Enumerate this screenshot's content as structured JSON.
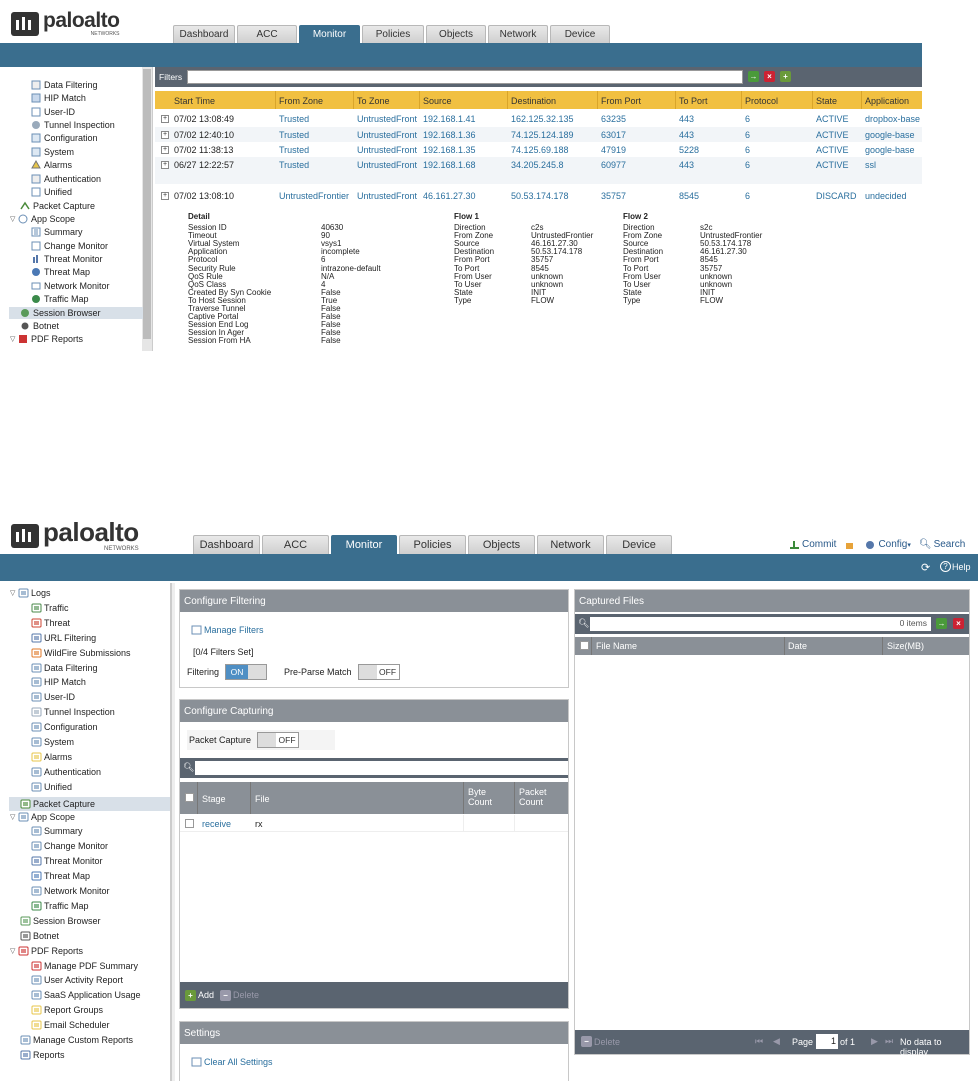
{
  "top": {
    "brand": {
      "wordmark": "paloalto",
      "sub": "NETWORKS"
    },
    "tabs": [
      "Dashboard",
      "ACC",
      "Monitor",
      "Policies",
      "Objects",
      "Network",
      "Device"
    ],
    "active_tab": "Monitor",
    "filters_label": "Filters",
    "tree": [
      "Data Filtering",
      "HIP Match",
      "User-ID",
      "Tunnel Inspection",
      "Configuration",
      "System",
      "Alarms",
      "Authentication",
      "Unified",
      "Packet Capture",
      "App Scope",
      "Summary",
      "Change Monitor",
      "Threat Monitor",
      "Threat Map",
      "Network Monitor",
      "Traffic Map",
      "Session Browser",
      "Botnet",
      "PDF Reports"
    ],
    "columns": [
      "Start Time",
      "From Zone",
      "To Zone",
      "Source",
      "Destination",
      "From Port",
      "To Port",
      "Protocol",
      "State",
      "Application"
    ],
    "rows": [
      [
        "07/02 13:08:49",
        "Trusted",
        "UntrustedFront...",
        "192.168.1.41",
        "162.125.32.135",
        "63235",
        "443",
        "6",
        "ACTIVE",
        "dropbox-base"
      ],
      [
        "07/02 12:40:10",
        "Trusted",
        "UntrustedFront...",
        "192.168.1.36",
        "74.125.124.189",
        "63017",
        "443",
        "6",
        "ACTIVE",
        "google-base"
      ],
      [
        "07/02 11:38:13",
        "Trusted",
        "UntrustedFront...",
        "192.168.1.35",
        "74.125.69.188",
        "47919",
        "5228",
        "6",
        "ACTIVE",
        "google-base"
      ],
      [
        "06/27 12:22:57",
        "Trusted",
        "UntrustedFront...",
        "192.168.1.68",
        "34.205.245.8",
        "60977",
        "443",
        "6",
        "ACTIVE",
        "ssl"
      ],
      [
        "07/02 13:08:10",
        "UntrustedFrontier",
        "UntrustedFront...",
        "46.161.27.30",
        "50.53.174.178",
        "35757",
        "8545",
        "6",
        "DISCARD",
        "undecided"
      ]
    ],
    "detail": {
      "title": "Detail",
      "rows": [
        [
          "Session ID",
          "40630"
        ],
        [
          "Timeout",
          "90"
        ],
        [
          "Virtual System",
          "vsys1"
        ],
        [
          "Application",
          "incomplete"
        ],
        [
          "Protocol",
          "6"
        ],
        [
          "Security Rule",
          "intrazone-default"
        ],
        [
          "QoS Rule",
          "N/A"
        ],
        [
          "QoS Class",
          "4"
        ],
        [
          "Created By Syn Cookie",
          "False"
        ],
        [
          "To Host Session",
          "True"
        ],
        [
          "Traverse Tunnel",
          "False"
        ],
        [
          "Captive Portal",
          "False"
        ],
        [
          "Session End Log",
          "False"
        ],
        [
          "Session In Ager",
          "False"
        ],
        [
          "Session From HA",
          "False"
        ]
      ]
    },
    "flow1": {
      "title": "Flow 1",
      "rows": [
        [
          "Direction",
          "c2s"
        ],
        [
          "From Zone",
          "UntrustedFrontier"
        ],
        [
          "Source",
          "46.161.27.30"
        ],
        [
          "Destination",
          "50.53.174.178"
        ],
        [
          "From Port",
          "35757"
        ],
        [
          "To Port",
          "8545"
        ],
        [
          "From User",
          "unknown"
        ],
        [
          "To User",
          "unknown"
        ],
        [
          "State",
          "INIT"
        ],
        [
          "Type",
          "FLOW"
        ]
      ]
    },
    "flow2": {
      "title": "Flow 2",
      "rows": [
        [
          "Direction",
          "s2c"
        ],
        [
          "From Zone",
          "UntrustedFrontier"
        ],
        [
          "Source",
          "50.53.174.178"
        ],
        [
          "Destination",
          "46.161.27.30"
        ],
        [
          "From Port",
          "8545"
        ],
        [
          "To Port",
          "35757"
        ],
        [
          "From User",
          "unknown"
        ],
        [
          "To User",
          "unknown"
        ],
        [
          "State",
          "INIT"
        ],
        [
          "Type",
          "FLOW"
        ]
      ]
    }
  },
  "bottom": {
    "brand": {
      "wordmark": "paloalto",
      "sub": "NETWORKS"
    },
    "tabs": [
      "Dashboard",
      "ACC",
      "Monitor",
      "Policies",
      "Objects",
      "Network",
      "Device"
    ],
    "active_tab": "Monitor",
    "header_links": {
      "commit": "Commit",
      "config": "Config",
      "search": "Search",
      "help": "Help"
    },
    "tree": [
      "Logs",
      "Traffic",
      "Threat",
      "URL Filtering",
      "WildFire Submissions",
      "Data Filtering",
      "HIP Match",
      "User-ID",
      "Tunnel Inspection",
      "Configuration",
      "System",
      "Alarms",
      "Authentication",
      "Unified",
      "Packet Capture",
      "App Scope",
      "Summary",
      "Change Monitor",
      "Threat Monitor",
      "Threat Map",
      "Network Monitor",
      "Traffic Map",
      "Session Browser",
      "Botnet",
      "PDF Reports",
      "Manage PDF Summary",
      "User Activity Report",
      "SaaS Application Usage",
      "Report Groups",
      "Email Scheduler",
      "Manage Custom Reports",
      "Reports"
    ],
    "filtering": {
      "title": "Configure Filtering",
      "manage": "Manage Filters",
      "set": "[0/4 Filters Set]",
      "filtering_label": "Filtering",
      "filtering_state": "ON",
      "preparse_label": "Pre-Parse Match",
      "preparse_state": "OFF"
    },
    "capturing": {
      "title": "Configure Capturing",
      "packet_capture_label": "Packet Capture",
      "packet_capture_state": "OFF",
      "columns": [
        "Stage",
        "File",
        "Byte Count",
        "Packet Count"
      ],
      "row": [
        "receive",
        "rx",
        "",
        ""
      ],
      "add": "Add",
      "delete": "Delete"
    },
    "settings": {
      "title": "Settings",
      "clear": "Clear All Settings"
    },
    "captured": {
      "title": "Captured Files",
      "count": "0 items",
      "columns": [
        "File Name",
        "Date",
        "Size(MB)"
      ],
      "delete": "Delete",
      "page": "Page",
      "page_value": "1",
      "of": "of 1",
      "nodata": "No data to display"
    }
  }
}
